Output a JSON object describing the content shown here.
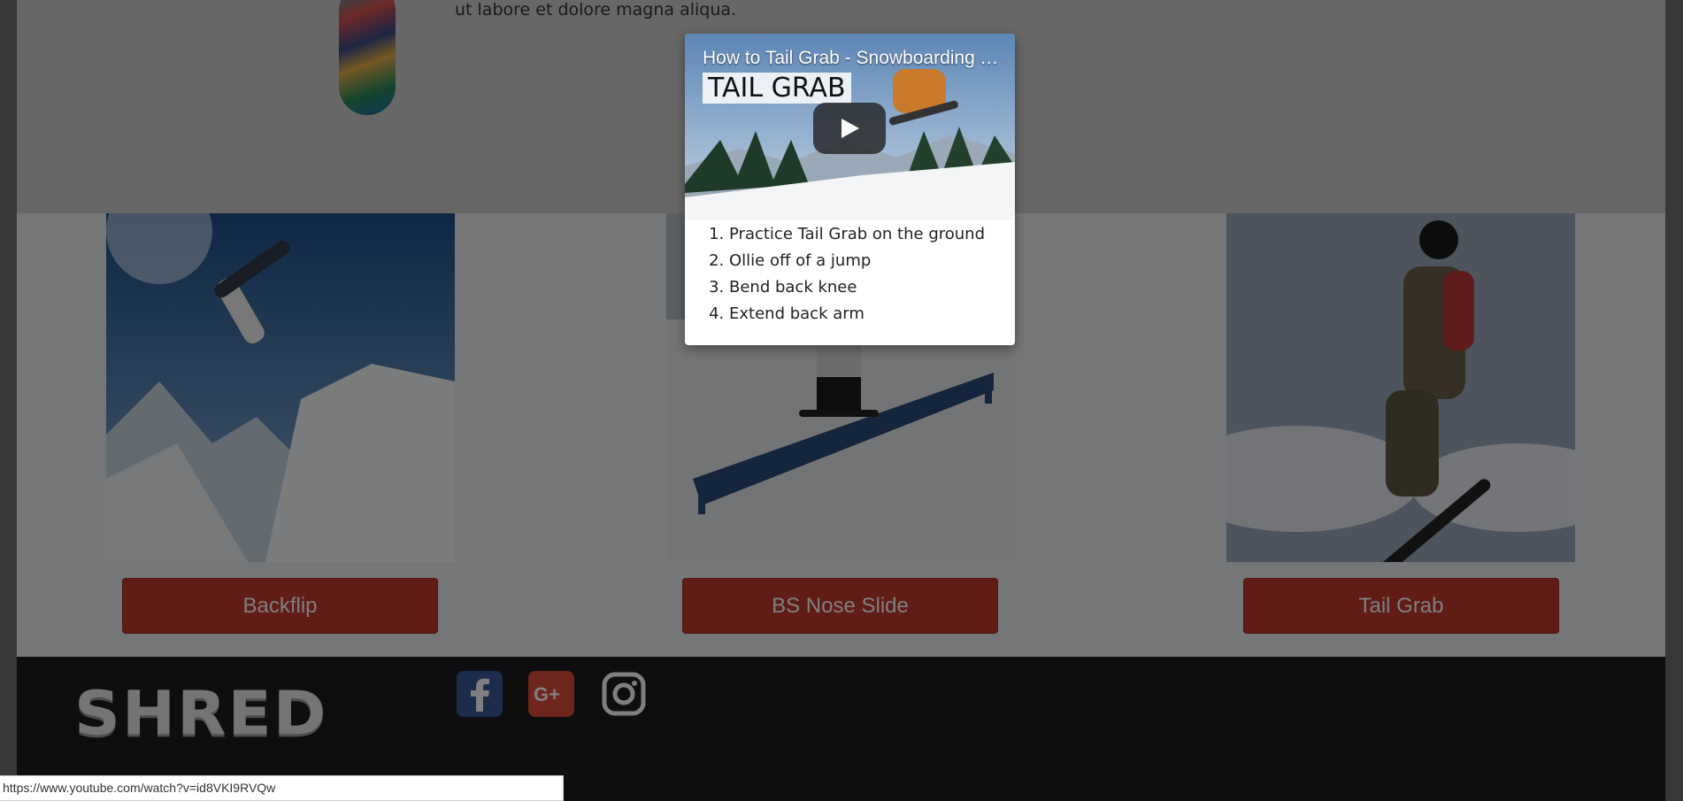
{
  "hero": {
    "text": "ut labore et dolore magna aliqua."
  },
  "tricks": [
    {
      "label": "Backflip"
    },
    {
      "label": "BS Nose Slide"
    },
    {
      "label": "Tail Grab"
    }
  ],
  "footer": {
    "logo_text": "SHRED",
    "social": [
      {
        "name": "facebook",
        "color": "#3b5998"
      },
      {
        "name": "google-plus",
        "color": "#dd4b39"
      },
      {
        "name": "instagram",
        "color": "#ffffff"
      }
    ]
  },
  "modal": {
    "video_title": "How to Tail Grab - Snowboarding Tricks",
    "thumbnail_caption": "TAIL GRAB",
    "steps": [
      "Practice Tail Grab on the ground",
      "Ollie off of a jump",
      "Bend back knee",
      "Extend back arm"
    ]
  },
  "status_bar": {
    "url": "https://www.youtube.com/watch?v=id8VKI9RVQw"
  },
  "colors": {
    "button_red": "#c0392b",
    "footer_dark": "#1c1d20"
  }
}
